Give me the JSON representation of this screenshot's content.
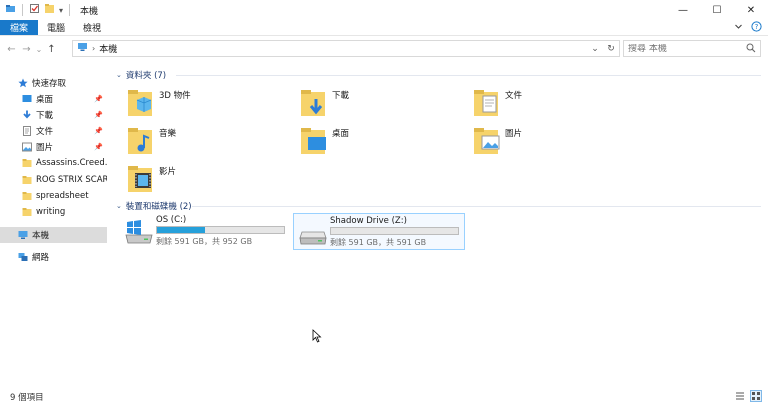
{
  "window": {
    "title": "本機",
    "controls": {
      "minimize": "—",
      "maximize": "☐",
      "close": "✕"
    }
  },
  "ribbon": {
    "tabs": [
      "檔案",
      "電腦",
      "檢視"
    ],
    "expand_icon": "chevron-down-icon",
    "help_icon": "help-icon"
  },
  "address": {
    "back": "←",
    "forward": "→",
    "recent": "⌄",
    "up": "↑",
    "path": "本機",
    "refresh": "↻"
  },
  "search": {
    "placeholder": "搜尋 本機"
  },
  "nav": {
    "quick_access": "快速存取",
    "pinned": [
      {
        "label": "桌面",
        "icon": "desktop-icon",
        "pinned": true
      },
      {
        "label": "下載",
        "icon": "download-icon",
        "pinned": true
      },
      {
        "label": "文件",
        "icon": "document-icon",
        "pinned": true
      },
      {
        "label": "圖片",
        "icon": "picture-icon",
        "pinned": true
      }
    ],
    "recent": [
      {
        "label": "Assassins.Creed.Od",
        "icon": "folder-icon"
      },
      {
        "label": "ROG STRIX SCAR I",
        "icon": "folder-icon"
      },
      {
        "label": "spreadsheet",
        "icon": "folder-icon"
      },
      {
        "label": "writing",
        "icon": "folder-icon"
      }
    ],
    "this_pc": "本機",
    "network": "網路"
  },
  "groups": {
    "folders_header": "資料夾 (7)",
    "drives_header": "裝置和磁碟機 (2)"
  },
  "folders": [
    {
      "label": "3D 物件",
      "icon": "3d-objects-folder-icon"
    },
    {
      "label": "下載",
      "icon": "downloads-folder-icon"
    },
    {
      "label": "文件",
      "icon": "documents-folder-icon"
    },
    {
      "label": "音樂",
      "icon": "music-folder-icon"
    },
    {
      "label": "桌面",
      "icon": "desktop-folder-icon"
    },
    {
      "label": "圖片",
      "icon": "pictures-folder-icon"
    },
    {
      "label": "影片",
      "icon": "videos-folder-icon"
    }
  ],
  "drives": [
    {
      "name": "OS (C:)",
      "info": "剩餘 591 GB，共 952 GB",
      "used_fraction": 0.38,
      "icon": "windows-drive-icon"
    },
    {
      "name": "Shadow Drive (Z:)",
      "info": "剩餘 591 GB，共 591 GB",
      "used_fraction": 0.0,
      "icon": "drive-icon"
    }
  ],
  "status": {
    "item_count": "9 個項目"
  },
  "colors": {
    "accent": "#1979ca",
    "progress": "#26a0da",
    "folder": "#f6d36b"
  }
}
